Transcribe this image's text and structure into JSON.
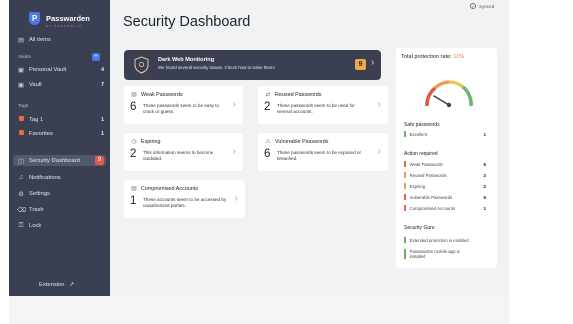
{
  "app": {
    "name": "Passwarden",
    "subtitle": "BY KEEPSOLID",
    "sync_status": "Synced"
  },
  "sidebar": {
    "all_items": "All items",
    "vaults_label": "Vaults",
    "add_symbol": "+",
    "vaults": [
      {
        "label": "Personal Vault",
        "count": "4",
        "icon": "person-vault-icon"
      },
      {
        "label": "Vault",
        "count": "7",
        "icon": "vault-icon"
      }
    ],
    "tags_label": "Tags",
    "tags": [
      {
        "label": "Tag 1",
        "count": "1",
        "color": "#e86a4a"
      },
      {
        "label": "Favorites",
        "count": "1",
        "color": "#e86a4a"
      }
    ],
    "nav": [
      {
        "label": "Security Dashboard",
        "active": true,
        "badge": "9"
      },
      {
        "label": "Notifications"
      },
      {
        "label": "Settings"
      },
      {
        "label": "Trash"
      },
      {
        "label": "Lock"
      }
    ],
    "extension": "Extension"
  },
  "main": {
    "title": "Security Dashboard",
    "banner": {
      "title": "Dark Web Monitoring",
      "text": "We found several security issues. Check how to solve them!",
      "count": "9"
    },
    "tiles": [
      {
        "title": "Weak Passwords",
        "count": "6",
        "desc": "These passwords seem to be easy to crack or guess."
      },
      {
        "title": "Reused Passwords",
        "count": "2",
        "desc": "These passwords seem to be used for several accounts."
      },
      {
        "title": "Expiring",
        "count": "2",
        "desc": "This information seems to become outdated."
      },
      {
        "title": "Vulnerable Passwords",
        "count": "6",
        "desc": "These passwords seem to be exposed or breached."
      },
      {
        "title": "Compromised Accounts",
        "count": "1",
        "desc": "These accounts seem to be accessed by unauthorized parties."
      }
    ]
  },
  "protection": {
    "title": "Total protection rate:",
    "rate": "11%",
    "safe_label": "Safe passwords",
    "safe": [
      {
        "label": "Excellent",
        "count": "1",
        "color": "#5cb85c"
      }
    ],
    "action_label": "Action required",
    "actions": [
      {
        "label": "Weak Passwords",
        "count": "6",
        "color": "#e8634a"
      },
      {
        "label": "Reused Passwords",
        "count": "2",
        "color": "#f0a04a"
      },
      {
        "label": "Expiring",
        "count": "2",
        "color": "#f0a04a"
      },
      {
        "label": "Vulnerable Passwords",
        "count": "6",
        "color": "#e8634a"
      },
      {
        "label": "Compromised Accounts",
        "count": "1",
        "color": "#e8634a"
      }
    ],
    "guru_label": "Security Guru",
    "guru": [
      {
        "label": "Extended protection is enabled",
        "color": "#5cb85c"
      },
      {
        "label": "Passwarden mobile app is installed",
        "color": "#5cb85c"
      }
    ]
  }
}
